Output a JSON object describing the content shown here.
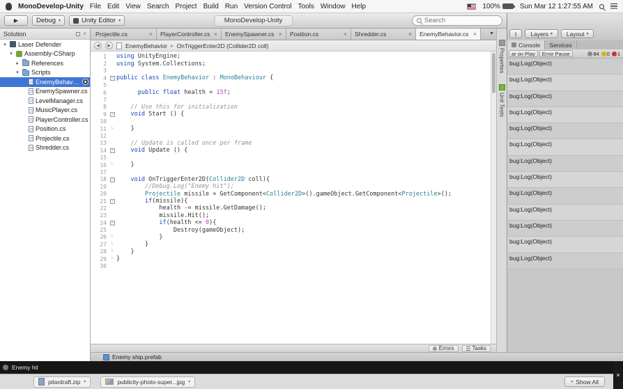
{
  "colors": {
    "selection": "#3f76d6",
    "keyword": "#1345c4",
    "type": "#267f99",
    "comment": "#949494",
    "number": "#c438c4",
    "error": "#cc3333",
    "warning": "#d6b500",
    "unity_green": "#73b838"
  },
  "menubar": {
    "app": "MonoDevelop-Unity",
    "items": [
      "File",
      "Edit",
      "View",
      "Search",
      "Project",
      "Build",
      "Run",
      "Version Control",
      "Tools",
      "Window",
      "Help"
    ],
    "battery": "100%",
    "clock": "Sun Mar 12 1:27:55 AM"
  },
  "toolbar": {
    "configuration": "Debug",
    "target": "Unity Editor",
    "window_title": "MonoDevelop-Unity",
    "search_placeholder": "Search"
  },
  "unity_top": {
    "buttons": [
      "t",
      "Layers",
      "Layout"
    ]
  },
  "solution": {
    "title": "Solution",
    "tree": [
      {
        "label": "Laser Defender",
        "indent": 0,
        "disclosure": "open",
        "icon": "solution"
      },
      {
        "label": "Assembly-CSharp",
        "indent": 1,
        "disclosure": "open",
        "icon": "project"
      },
      {
        "label": "References",
        "indent": 2,
        "disclosure": "closed",
        "icon": "references"
      },
      {
        "label": "Scripts",
        "indent": 2,
        "disclosure": "open",
        "icon": "folder"
      },
      {
        "label": "EnemyBehavior.cs",
        "indent": 3,
        "icon": "file",
        "selected": true
      },
      {
        "label": "EnemySpawner.cs",
        "indent": 3,
        "icon": "file"
      },
      {
        "label": "LevelManager.cs",
        "indent": 3,
        "icon": "file"
      },
      {
        "label": "MusicPlayer.cs",
        "indent": 3,
        "icon": "file"
      },
      {
        "label": "PlayerController.cs",
        "indent": 3,
        "icon": "file"
      },
      {
        "label": "Position.cs",
        "indent": 3,
        "icon": "file"
      },
      {
        "label": "Projectile.cs",
        "indent": 3,
        "icon": "file"
      },
      {
        "label": "Shredder.cs",
        "indent": 3,
        "icon": "file"
      }
    ]
  },
  "editor": {
    "tabs": [
      {
        "label": "Projectile.cs"
      },
      {
        "label": "PlayerController.cs"
      },
      {
        "label": "EnemySpawner.cs"
      },
      {
        "label": "Position.cs"
      },
      {
        "label": "Shredder.cs"
      },
      {
        "label": "EnemyBehavior.cs",
        "active": true
      }
    ],
    "breadcrumb": [
      "EnemyBehavior",
      "OnTriggerEnter2D (Collider2D coll)"
    ],
    "pads": [
      {
        "label": "Properties",
        "icon": "properties"
      },
      {
        "label": "Unit Tests",
        "icon": "unittests"
      }
    ],
    "errors_button": "Errors",
    "tasks_button": "Tasks",
    "code": [
      {
        "n": 1,
        "fold": "",
        "seg": [
          [
            "k",
            "using"
          ],
          [
            "p",
            " UnityEngine;"
          ]
        ]
      },
      {
        "n": 2,
        "fold": "",
        "seg": [
          [
            "k",
            "using"
          ],
          [
            "p",
            " System.Collections;"
          ]
        ]
      },
      {
        "n": 3,
        "fold": "",
        "seg": []
      },
      {
        "n": 4,
        "fold": "box",
        "seg": [
          [
            "k",
            "public"
          ],
          [
            "p",
            " "
          ],
          [
            "k",
            "class"
          ],
          [
            "p",
            " "
          ],
          [
            "t",
            "EnemyBehavior"
          ],
          [
            "p",
            " : "
          ],
          [
            "t",
            "MonoBehaviour"
          ],
          [
            "p",
            " {"
          ]
        ]
      },
      {
        "n": 5,
        "fold": "",
        "seg": []
      },
      {
        "n": 6,
        "fold": "",
        "seg": [
          [
            "p",
            "      "
          ],
          [
            "k",
            "public"
          ],
          [
            "p",
            " "
          ],
          [
            "k",
            "float"
          ],
          [
            "p",
            " health = "
          ],
          [
            "num",
            "15f"
          ],
          [
            "p",
            ";"
          ]
        ]
      },
      {
        "n": 7,
        "fold": "",
        "seg": []
      },
      {
        "n": 8,
        "fold": "",
        "seg": [
          [
            "p",
            "    "
          ],
          [
            "c",
            "// Use this for initialization"
          ]
        ]
      },
      {
        "n": 9,
        "fold": "box",
        "seg": [
          [
            "p",
            "    "
          ],
          [
            "k",
            "void"
          ],
          [
            "p",
            " Start () {"
          ]
        ]
      },
      {
        "n": 10,
        "fold": "",
        "seg": []
      },
      {
        "n": 11,
        "fold": "end",
        "seg": [
          [
            "p",
            "    }"
          ]
        ]
      },
      {
        "n": 12,
        "fold": "",
        "seg": []
      },
      {
        "n": 13,
        "fold": "",
        "seg": [
          [
            "p",
            "    "
          ],
          [
            "c",
            "// Update is called once per frame"
          ]
        ]
      },
      {
        "n": 14,
        "fold": "box",
        "seg": [
          [
            "p",
            "    "
          ],
          [
            "k",
            "void"
          ],
          [
            "p",
            " Update () {"
          ]
        ]
      },
      {
        "n": 15,
        "fold": "",
        "seg": []
      },
      {
        "n": 16,
        "fold": "end",
        "seg": [
          [
            "p",
            "    }"
          ]
        ]
      },
      {
        "n": 17,
        "fold": "",
        "seg": []
      },
      {
        "n": 18,
        "fold": "box",
        "seg": [
          [
            "p",
            "    "
          ],
          [
            "k",
            "void"
          ],
          [
            "p",
            " OnTriggerEnter2D("
          ],
          [
            "t",
            "Collider2D"
          ],
          [
            "p",
            " coll){"
          ]
        ]
      },
      {
        "n": 19,
        "fold": "",
        "seg": [
          [
            "p",
            "        "
          ],
          [
            "c",
            "//Debug.Log(\"Enemy hit\");"
          ]
        ]
      },
      {
        "n": 20,
        "fold": "",
        "seg": [
          [
            "p",
            "        "
          ],
          [
            "t",
            "Projectile"
          ],
          [
            "p",
            " missile = GetComponent<"
          ],
          [
            "t",
            "Collider2D"
          ],
          [
            "p",
            ">().gameObject.GetComponent<"
          ],
          [
            "t",
            "Projectile"
          ],
          [
            "p",
            ">();"
          ]
        ]
      },
      {
        "n": 21,
        "fold": "box",
        "seg": [
          [
            "p",
            "        "
          ],
          [
            "k",
            "if"
          ],
          [
            "p",
            "(missile){"
          ]
        ]
      },
      {
        "n": 22,
        "fold": "",
        "seg": [
          [
            "p",
            "            health -= missile.GetDamage();"
          ]
        ]
      },
      {
        "n": 23,
        "fold": "",
        "seg": [
          [
            "p",
            "            missile.Hit();"
          ]
        ]
      },
      {
        "n": 24,
        "fold": "box",
        "seg": [
          [
            "p",
            "            "
          ],
          [
            "k",
            "if"
          ],
          [
            "p",
            "(health <= "
          ],
          [
            "num",
            "0"
          ],
          [
            "p",
            "){"
          ]
        ]
      },
      {
        "n": 25,
        "fold": "",
        "seg": [
          [
            "p",
            "                Destroy(gameObject);"
          ]
        ]
      },
      {
        "n": 26,
        "fold": "end",
        "seg": [
          [
            "p",
            "            }"
          ]
        ]
      },
      {
        "n": 27,
        "fold": "end",
        "seg": [
          [
            "p",
            "        }"
          ]
        ]
      },
      {
        "n": 28,
        "fold": "end",
        "seg": [
          [
            "p",
            "    }"
          ]
        ]
      },
      {
        "n": 29,
        "fold": "end",
        "seg": [
          [
            "p",
            "}"
          ]
        ]
      },
      {
        "n": 30,
        "fold": "",
        "seg": []
      }
    ]
  },
  "unity_console": {
    "tabs": [
      "Console",
      "Services"
    ],
    "toolbar_buttons": [
      "ar on Play",
      "Error Pause"
    ],
    "counts": [
      {
        "value": "84",
        "kind": "log"
      },
      {
        "value": "0",
        "kind": "warn"
      },
      {
        "value": "1",
        "kind": "error"
      }
    ],
    "rows": [
      "bug:Log(Object)",
      "bug:Log(Object)",
      "bug:Log(Object)",
      "bug:Log(Object)",
      "bug:Log(Object)",
      "bug:Log(Object)",
      "bug:Log(Object)",
      "bug:Log(Object)",
      "bug:Log(Object)",
      "bug:Log(Object)",
      "bug:Log(Object)",
      "bug:Log(Object)",
      "bug:Log(Object)"
    ]
  },
  "status": {
    "prefab_bar": "Enemy ship.prefab",
    "log_text": "Enemy hit"
  },
  "downloads": {
    "chips": [
      {
        "label": "pilardraft.zip",
        "icon": "zip"
      },
      {
        "label": "publicity-photo-super...jpg",
        "icon": "img"
      }
    ],
    "show_all": "Show All"
  }
}
